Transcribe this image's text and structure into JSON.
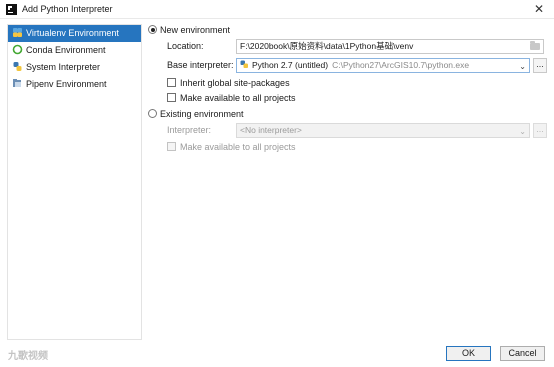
{
  "window": {
    "title": "Add Python Interpreter",
    "close_glyph": "✕"
  },
  "sidebar": {
    "items": [
      {
        "label": "Virtualenv Environment",
        "icon": "virtualenv-icon",
        "selected": true
      },
      {
        "label": "Conda Environment",
        "icon": "conda-icon",
        "selected": false
      },
      {
        "label": "System Interpreter",
        "icon": "python-icon",
        "selected": false
      },
      {
        "label": "Pipenv Environment",
        "icon": "pipenv-icon",
        "selected": false
      }
    ]
  },
  "new_env": {
    "radio_label": "New environment",
    "selected": true,
    "location_label": "Location:",
    "location_value": "F:\\2020book\\原始资料\\data\\1Python基础\\venv",
    "base_label": "Base interpreter:",
    "base_value": "Python 2.7 (untitled)",
    "base_path": "C:\\Python27\\ArcGIS10.7\\python.exe",
    "dots": "...",
    "inherit_label": "Inherit global site-packages",
    "inherit_checked": false,
    "available_label": "Make available to all projects",
    "available_checked": false
  },
  "existing_env": {
    "radio_label": "Existing environment",
    "selected": false,
    "interpreter_label": "Interpreter:",
    "interpreter_value": "<No interpreter>",
    "dots": "...",
    "available_label": "Make available to all projects",
    "available_checked": false
  },
  "footer": {
    "ok_label": "OK",
    "cancel_label": "Cancel",
    "watermark": "九歌视频"
  },
  "colors": {
    "selection": "#2675bf",
    "disabled_text": "#9a9a9a",
    "field_focus": "#8ab4e0"
  }
}
